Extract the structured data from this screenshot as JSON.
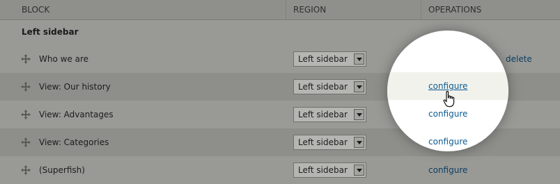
{
  "header": {
    "block": "BLOCK",
    "region": "REGION",
    "operations": "OPERATIONS"
  },
  "region_title": "Left sidebar",
  "rows": [
    {
      "label": "Who we are",
      "region": "Left sidebar",
      "configure": "configure",
      "delete": "delete"
    },
    {
      "label": "View: Our history",
      "region": "Left sidebar",
      "configure": "configure"
    },
    {
      "label": "View: Advantages",
      "region": "Left sidebar",
      "configure": "configure"
    },
    {
      "label": "View: Categories",
      "region": "Left sidebar",
      "configure": "configure"
    },
    {
      "label": "(Superfish)",
      "region": "Left sidebar",
      "configure": "configure"
    }
  ],
  "icons": {
    "drag": "move-arrows-icon",
    "cursor": "hand-pointer-icon",
    "dropdown": "chevron-down-icon"
  },
  "colors": {
    "link": "#0b5b93",
    "overlay": "#999a96",
    "spotlight": "#ffffff"
  }
}
